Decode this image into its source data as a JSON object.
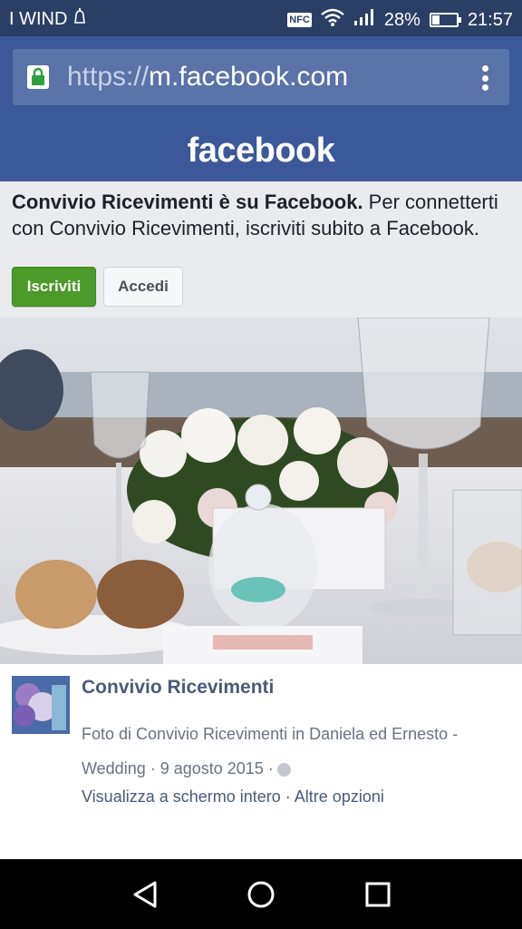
{
  "status_bar": {
    "carrier": "I WIND",
    "nfc": "NFC",
    "battery_text": "28%",
    "battery_level": 0.28,
    "time": "21:57"
  },
  "browser": {
    "url_scheme": "https://",
    "url_host": "m.facebook.com",
    "lock_icon": "lock-icon",
    "menu_icon": "kebab-menu-icon"
  },
  "facebook": {
    "logo": "facebook"
  },
  "signup_prompt": {
    "bold": "Convivio Ricevimenti è su Facebook.",
    "rest": " Per connetterti con Convivio Ricevimenti, iscriviti subito a Facebook.",
    "signup_label": "Iscriviti",
    "login_label": "Accedi"
  },
  "post": {
    "page_name": "Convivio Ricevimenti",
    "caption": "Foto di Convivio Ricevimenti in Daniela ed Ernesto - Wedding · 9 agosto 2015 ·",
    "fullscreen_link": "Visualizza a schermo intero",
    "separator": " · ",
    "options_link": "Altre opzioni"
  },
  "colors": {
    "fb_blue": "#3b5998",
    "status_bar": "#2b3f66",
    "signup_green": "#4c9a2a"
  }
}
